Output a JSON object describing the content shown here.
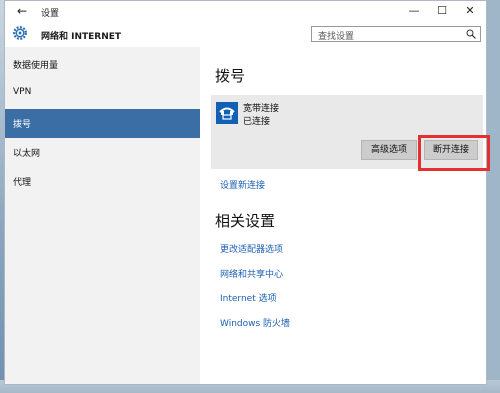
{
  "window": {
    "back_glyph": "←",
    "title": "设置",
    "min": "—",
    "max": "☐",
    "close": "✕"
  },
  "header": {
    "section": "网络和 INTERNET",
    "search_placeholder": "查找设置"
  },
  "sidebar": {
    "items": [
      "数据使用量",
      "VPN",
      "拨号",
      "以太网",
      "代理"
    ],
    "active_index": 2
  },
  "main": {
    "heading": "拨号",
    "connection": {
      "name": "宽带连接",
      "status": "已连接"
    },
    "advanced_button": "高级选项",
    "disconnect_button": "断开连接",
    "setup_link": "设置新连接",
    "related_heading": "相关设置",
    "related_links": [
      "更改适配器选项",
      "网络和共享中心",
      "Internet 选项",
      "Windows 防火墙"
    ]
  },
  "colors": {
    "accent": "#3b6ea5",
    "link": "#1c5fb4",
    "highlight": "#e33131"
  }
}
